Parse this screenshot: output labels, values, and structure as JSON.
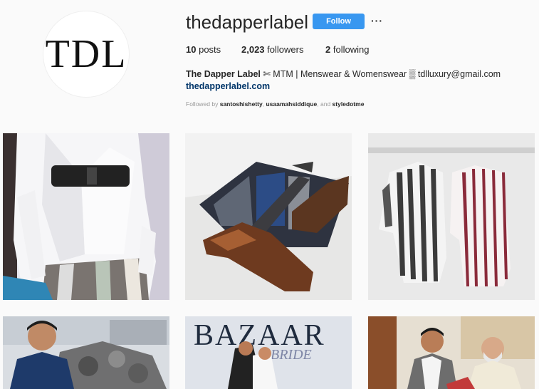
{
  "profile": {
    "avatar_text": "TDL",
    "username": "thedapperlabel",
    "follow_label": "Follow",
    "more_label": "···"
  },
  "stats": {
    "posts_count": "10",
    "posts_label": "posts",
    "followers_count": "2,023",
    "followers_label": "followers",
    "following_count": "2",
    "following_label": "following"
  },
  "bio": {
    "name": "The Dapper Label",
    "description": " ✄ MTM | Menswear & Womenswear ▒ tdlluxury@gmail.com",
    "link": "thedapperlabel.com"
  },
  "followed_by": {
    "prefix": "Followed by ",
    "user1": "santoshishetty",
    "sep1": ", ",
    "user2": "usaamahsiddique",
    "sep2": ", and ",
    "user3": "styledotme"
  },
  "posts": {
    "tile5_text1": "BAZAAR",
    "tile5_text2": "BRIDE"
  },
  "colors": {
    "follow_button": "#3897f0",
    "link": "#003569",
    "background": "#fafafa"
  }
}
